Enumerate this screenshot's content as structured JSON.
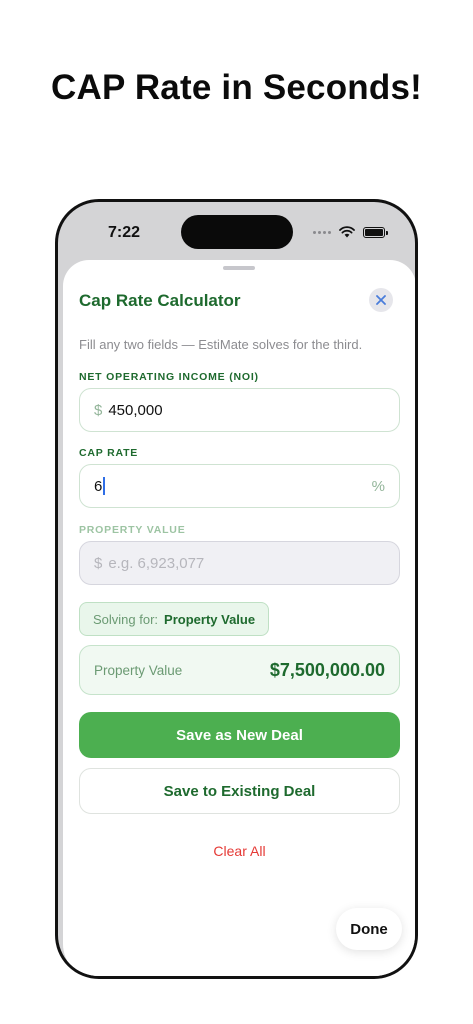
{
  "headline": "CAP Rate in Seconds!",
  "status_bar": {
    "time": "7:22",
    "icons": [
      "cellular-dots-icon",
      "wifi-icon",
      "battery-icon"
    ]
  },
  "sheet": {
    "title": "Cap Rate Calculator",
    "subtitle": "Fill any two fields — EstiMate solves for the third.",
    "close_icon": "close-icon"
  },
  "fields": {
    "noi": {
      "label": "NET OPERATING INCOME (NOI)",
      "prefix": "$",
      "value": "450,000"
    },
    "cap_rate": {
      "label": "CAP RATE",
      "value": "6",
      "suffix": "%"
    },
    "property_value": {
      "label": "PROPERTY VALUE",
      "prefix": "$",
      "placeholder": "e.g. 6,923,077"
    }
  },
  "solving": {
    "label": "Solving for:",
    "value": "Property Value"
  },
  "result": {
    "label": "Property Value",
    "value": "$7,500,000.00"
  },
  "buttons": {
    "save_new": "Save as New Deal",
    "save_existing": "Save to Existing Deal",
    "clear_all": "Clear All",
    "done": "Done"
  },
  "colors": {
    "brand_green": "#1e6a2e",
    "primary_button": "#4caf50",
    "destructive": "#e53935"
  }
}
